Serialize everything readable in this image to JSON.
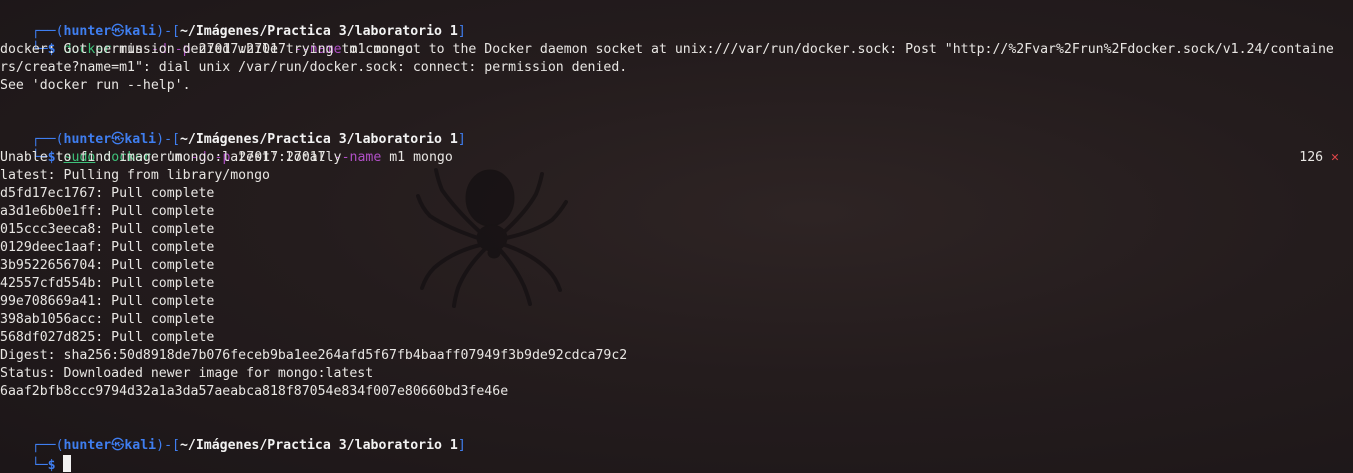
{
  "prompt": {
    "user": "hunter",
    "at_symbol": "㉿",
    "host": "kali",
    "path": "~/Imágenes/Practica 3/laboratorio 1",
    "dollar": "$"
  },
  "commands": [
    {
      "parts": [
        "docker",
        "run",
        "-d",
        "-p",
        "27017:27017",
        "--name",
        "m1",
        "mongo"
      ]
    },
    {
      "parts": [
        "sudo",
        "docker",
        "run",
        "-d",
        "-p",
        "27017:27017",
        "--name",
        "m1",
        "mongo"
      ]
    }
  ],
  "output1": [
    "docker: Got permission denied while trying to connect to the Docker daemon socket at unix:///var/run/docker.sock: Post \"http://%2Fvar%2Frun%2Fdocker.sock/v1.24/containe",
    "rs/create?name=m1\": dial unix /var/run/docker.sock: connect: permission denied.",
    "See 'docker run --help'."
  ],
  "exit_status": {
    "code": "126",
    "mark": "✕"
  },
  "output2": [
    "Unable to find image 'mongo:latest' locally",
    "latest: Pulling from library/mongo",
    "d5fd17ec1767: Pull complete",
    "a3d1e6b0e1ff: Pull complete",
    "015ccc3eeca8: Pull complete",
    "0129deec1aaf: Pull complete",
    "3b9522656704: Pull complete",
    "42557cfd554b: Pull complete",
    "99e708669a41: Pull complete",
    "398ab1056acc: Pull complete",
    "568df027d825: Pull complete",
    "Digest: sha256:50d8918de7b076feceb9ba1ee264afd5f67fb4baaff07949f3b9de92cdca79c2",
    "Status: Downloaded newer image for mongo:latest",
    "6aaf2bfb8ccc9794d32a1a3da57aeabca818f87054e834f007e80660bd3fe46e"
  ]
}
